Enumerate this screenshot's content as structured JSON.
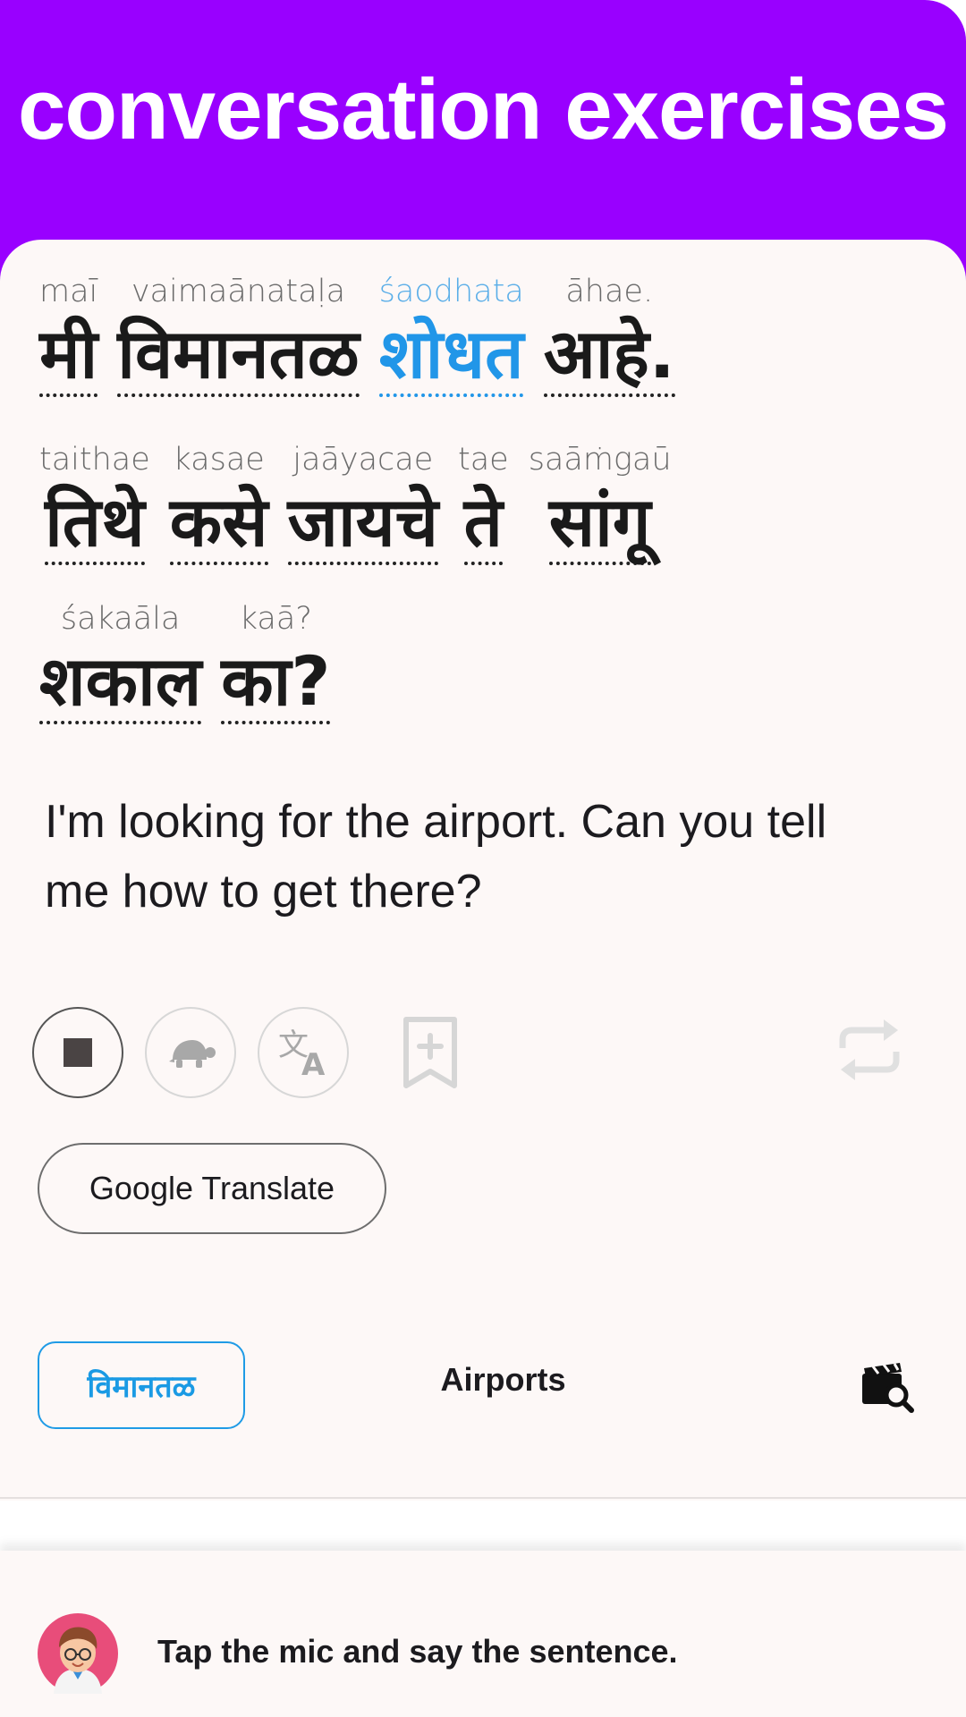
{
  "header": {
    "title": "conversation exercises"
  },
  "sentence": {
    "lines": [
      [
        {
          "native": "मी",
          "translit": "maī"
        },
        {
          "native": "विमानतळ",
          "translit": "vaimaānataḷa"
        },
        {
          "native": "शोधत",
          "translit": "śaodhata"
        },
        {
          "native": "आहे.",
          "translit": "āhae."
        }
      ],
      [
        {
          "native": "तिथे",
          "translit": "taithae"
        },
        {
          "native": "कसे",
          "translit": "kasae"
        },
        {
          "native": "जायचे",
          "translit": "jaāyacae"
        },
        {
          "native": "ते",
          "translit": "tae"
        },
        {
          "native": "सांगू",
          "translit": "saāṁgaū"
        }
      ],
      [
        {
          "native": "शकाल",
          "translit": "śakaāla"
        },
        {
          "native": "का?",
          "translit": "kaā?"
        }
      ]
    ],
    "translation": "I'm looking for the airport. Can you tell me how to get there?"
  },
  "controls": {
    "stop_icon": "stop-icon",
    "slow_icon": "turtle-icon",
    "translate_icon": "translate-icon",
    "bookmark_icon": "bookmark-add-icon",
    "repeat_icon": "repeat-icon",
    "google_translate_label": "Google Translate"
  },
  "topic": {
    "keyword": "विमानतळ",
    "name": "Airports",
    "video_icon": "video-search-icon"
  },
  "bottom": {
    "avatar_icon": "tutor-avatar-icon",
    "hint": "Tap the mic and say the sentence."
  },
  "colors": {
    "header": "#9900ff",
    "highlight": "#2196e8",
    "background": "#fdf8f7"
  }
}
